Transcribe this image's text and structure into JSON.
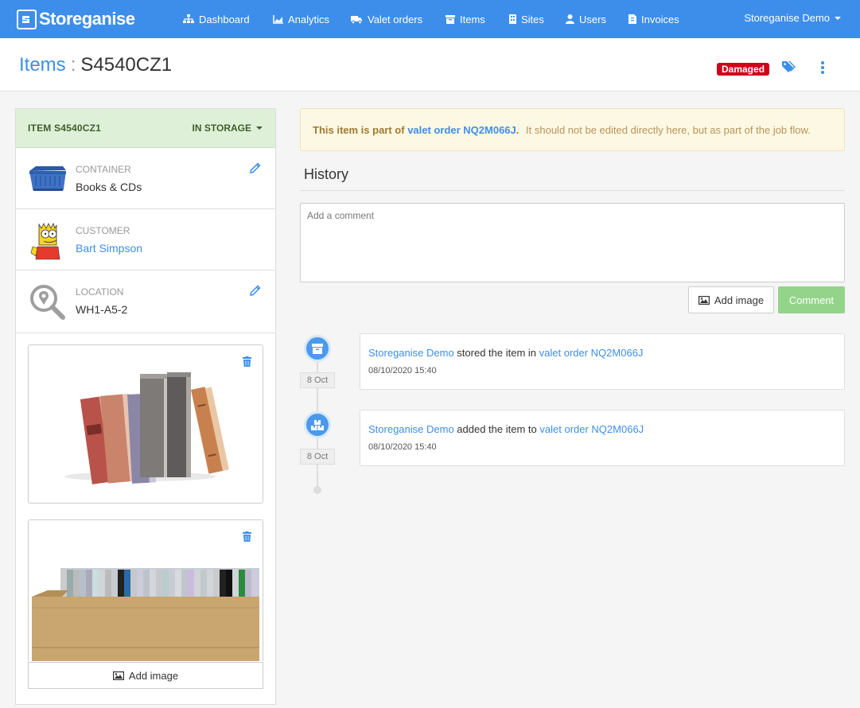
{
  "navbar": {
    "brand": "Storeganise",
    "items": [
      {
        "label": "Dashboard",
        "icon": "sitemap-icon"
      },
      {
        "label": "Analytics",
        "icon": "area-chart-icon"
      },
      {
        "label": "Valet orders",
        "icon": "truck-icon"
      },
      {
        "label": "Items",
        "icon": "archive-box-icon"
      },
      {
        "label": "Sites",
        "icon": "building-icon"
      },
      {
        "label": "Users",
        "icon": "user-icon"
      },
      {
        "label": "Invoices",
        "icon": "invoice-icon"
      }
    ],
    "account": "Storeganise Demo",
    "bg_color": "#3d8eea"
  },
  "page": {
    "crumb": "Items",
    "separator": ":",
    "title": "S4540CZ1",
    "badge": "Damaged",
    "badge_color": "#d0021b"
  },
  "item": {
    "id_label": "ITEM S4540CZ1",
    "status": "IN STORAGE",
    "container": {
      "label": "CONTAINER",
      "value": "Books & CDs"
    },
    "customer": {
      "label": "CUSTOMER",
      "value": "Bart Simpson"
    },
    "location": {
      "label": "LOCATION",
      "value": "WH1-A5-2"
    },
    "add_image_label": "Add image"
  },
  "alert": {
    "prefix": "This item is part of",
    "link": "valet order NQ2M066J",
    "suffix": ".",
    "note": "It should not be edited directly here, but as part of the job flow."
  },
  "history": {
    "title": "History",
    "comment_placeholder": "Add a comment",
    "add_image_label": "Add image",
    "comment_label": "Comment",
    "events": [
      {
        "icon": "archive-box-icon",
        "date": "8 Oct",
        "actor": "Storeganise Demo",
        "action": "stored the item in",
        "target": "valet order NQ2M066J",
        "timestamp": "08/10/2020 15:40"
      },
      {
        "icon": "boxes-icon",
        "date": "8 Oct",
        "actor": "Storeganise Demo",
        "action": "added the item to",
        "target": "valet order NQ2M066J",
        "timestamp": "08/10/2020 15:40"
      }
    ]
  }
}
